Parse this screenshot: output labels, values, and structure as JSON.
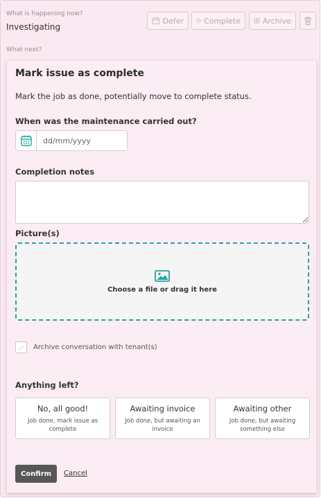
{
  "status": {
    "label": "What is happening now?",
    "value": "Investigating"
  },
  "toolbar": {
    "defer_label": "Defer",
    "complete_label": "Complete",
    "archive_label": "Archive"
  },
  "next": {
    "label": "What next?"
  },
  "form": {
    "title": "Mark issue as complete",
    "description": "Mark the job as done, potentially move to complete status.",
    "date_question": "When was the maintenance carried out?",
    "date_placeholder": "dd/mm/yyyy",
    "notes_label": "Completion notes",
    "notes_value": "",
    "pictures_label": "Picture(s)",
    "dropzone_text": "Choose a file or drag it here",
    "archive_checkbox_label": "Archive conversation with tenant(s)",
    "archive_checked": false,
    "anything_left_label": "Anything left?",
    "options": [
      {
        "title": "No, all good!",
        "subtitle": "Job done, mark issue as complete"
      },
      {
        "title": "Awaiting invoice",
        "subtitle": "Job done, but awaiting an invoice"
      },
      {
        "title": "Awaiting other",
        "subtitle": "Job done, but awaiting something else"
      }
    ],
    "confirm_label": "Confirm",
    "cancel_label": "Cancel"
  },
  "icons": {
    "defer": "calendar-icon",
    "complete": "check-circle-icon",
    "archive": "archive-box-icon",
    "delete": "trash-icon",
    "date": "calendar-icon",
    "dropzone": "image-icon"
  },
  "colors": {
    "background": "#fbe9f1",
    "accent": "#1fa79d",
    "confirm_button": "#575757"
  }
}
